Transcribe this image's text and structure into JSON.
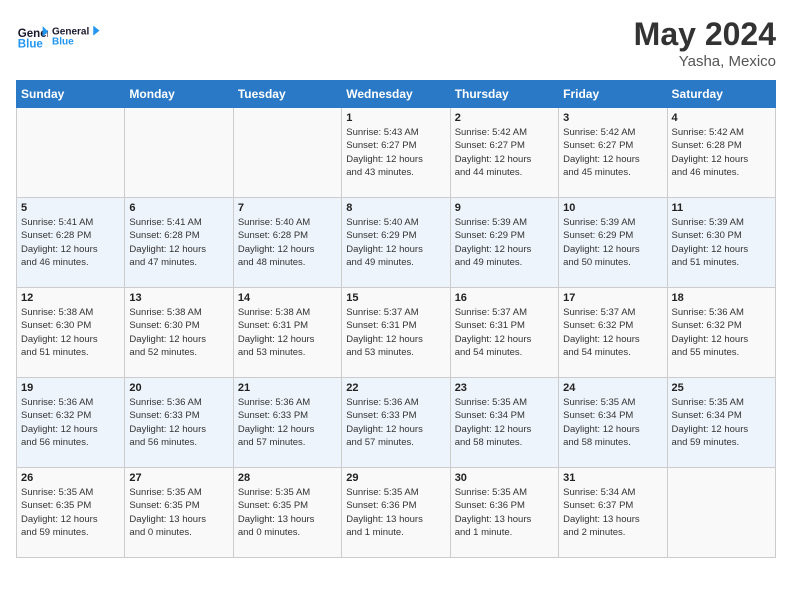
{
  "header": {
    "logo_line1": "General",
    "logo_line2": "Blue",
    "month": "May 2024",
    "location": "Yasha, Mexico"
  },
  "days_of_week": [
    "Sunday",
    "Monday",
    "Tuesday",
    "Wednesday",
    "Thursday",
    "Friday",
    "Saturday"
  ],
  "weeks": [
    [
      {
        "day": "",
        "info": ""
      },
      {
        "day": "",
        "info": ""
      },
      {
        "day": "",
        "info": ""
      },
      {
        "day": "1",
        "info": "Sunrise: 5:43 AM\nSunset: 6:27 PM\nDaylight: 12 hours\nand 43 minutes."
      },
      {
        "day": "2",
        "info": "Sunrise: 5:42 AM\nSunset: 6:27 PM\nDaylight: 12 hours\nand 44 minutes."
      },
      {
        "day": "3",
        "info": "Sunrise: 5:42 AM\nSunset: 6:27 PM\nDaylight: 12 hours\nand 45 minutes."
      },
      {
        "day": "4",
        "info": "Sunrise: 5:42 AM\nSunset: 6:28 PM\nDaylight: 12 hours\nand 46 minutes."
      }
    ],
    [
      {
        "day": "5",
        "info": "Sunrise: 5:41 AM\nSunset: 6:28 PM\nDaylight: 12 hours\nand 46 minutes."
      },
      {
        "day": "6",
        "info": "Sunrise: 5:41 AM\nSunset: 6:28 PM\nDaylight: 12 hours\nand 47 minutes."
      },
      {
        "day": "7",
        "info": "Sunrise: 5:40 AM\nSunset: 6:28 PM\nDaylight: 12 hours\nand 48 minutes."
      },
      {
        "day": "8",
        "info": "Sunrise: 5:40 AM\nSunset: 6:29 PM\nDaylight: 12 hours\nand 49 minutes."
      },
      {
        "day": "9",
        "info": "Sunrise: 5:39 AM\nSunset: 6:29 PM\nDaylight: 12 hours\nand 49 minutes."
      },
      {
        "day": "10",
        "info": "Sunrise: 5:39 AM\nSunset: 6:29 PM\nDaylight: 12 hours\nand 50 minutes."
      },
      {
        "day": "11",
        "info": "Sunrise: 5:39 AM\nSunset: 6:30 PM\nDaylight: 12 hours\nand 51 minutes."
      }
    ],
    [
      {
        "day": "12",
        "info": "Sunrise: 5:38 AM\nSunset: 6:30 PM\nDaylight: 12 hours\nand 51 minutes."
      },
      {
        "day": "13",
        "info": "Sunrise: 5:38 AM\nSunset: 6:30 PM\nDaylight: 12 hours\nand 52 minutes."
      },
      {
        "day": "14",
        "info": "Sunrise: 5:38 AM\nSunset: 6:31 PM\nDaylight: 12 hours\nand 53 minutes."
      },
      {
        "day": "15",
        "info": "Sunrise: 5:37 AM\nSunset: 6:31 PM\nDaylight: 12 hours\nand 53 minutes."
      },
      {
        "day": "16",
        "info": "Sunrise: 5:37 AM\nSunset: 6:31 PM\nDaylight: 12 hours\nand 54 minutes."
      },
      {
        "day": "17",
        "info": "Sunrise: 5:37 AM\nSunset: 6:32 PM\nDaylight: 12 hours\nand 54 minutes."
      },
      {
        "day": "18",
        "info": "Sunrise: 5:36 AM\nSunset: 6:32 PM\nDaylight: 12 hours\nand 55 minutes."
      }
    ],
    [
      {
        "day": "19",
        "info": "Sunrise: 5:36 AM\nSunset: 6:32 PM\nDaylight: 12 hours\nand 56 minutes."
      },
      {
        "day": "20",
        "info": "Sunrise: 5:36 AM\nSunset: 6:33 PM\nDaylight: 12 hours\nand 56 minutes."
      },
      {
        "day": "21",
        "info": "Sunrise: 5:36 AM\nSunset: 6:33 PM\nDaylight: 12 hours\nand 57 minutes."
      },
      {
        "day": "22",
        "info": "Sunrise: 5:36 AM\nSunset: 6:33 PM\nDaylight: 12 hours\nand 57 minutes."
      },
      {
        "day": "23",
        "info": "Sunrise: 5:35 AM\nSunset: 6:34 PM\nDaylight: 12 hours\nand 58 minutes."
      },
      {
        "day": "24",
        "info": "Sunrise: 5:35 AM\nSunset: 6:34 PM\nDaylight: 12 hours\nand 58 minutes."
      },
      {
        "day": "25",
        "info": "Sunrise: 5:35 AM\nSunset: 6:34 PM\nDaylight: 12 hours\nand 59 minutes."
      }
    ],
    [
      {
        "day": "26",
        "info": "Sunrise: 5:35 AM\nSunset: 6:35 PM\nDaylight: 12 hours\nand 59 minutes."
      },
      {
        "day": "27",
        "info": "Sunrise: 5:35 AM\nSunset: 6:35 PM\nDaylight: 13 hours\nand 0 minutes."
      },
      {
        "day": "28",
        "info": "Sunrise: 5:35 AM\nSunset: 6:35 PM\nDaylight: 13 hours\nand 0 minutes."
      },
      {
        "day": "29",
        "info": "Sunrise: 5:35 AM\nSunset: 6:36 PM\nDaylight: 13 hours\nand 1 minute."
      },
      {
        "day": "30",
        "info": "Sunrise: 5:35 AM\nSunset: 6:36 PM\nDaylight: 13 hours\nand 1 minute."
      },
      {
        "day": "31",
        "info": "Sunrise: 5:34 AM\nSunset: 6:37 PM\nDaylight: 13 hours\nand 2 minutes."
      },
      {
        "day": "",
        "info": ""
      }
    ]
  ]
}
